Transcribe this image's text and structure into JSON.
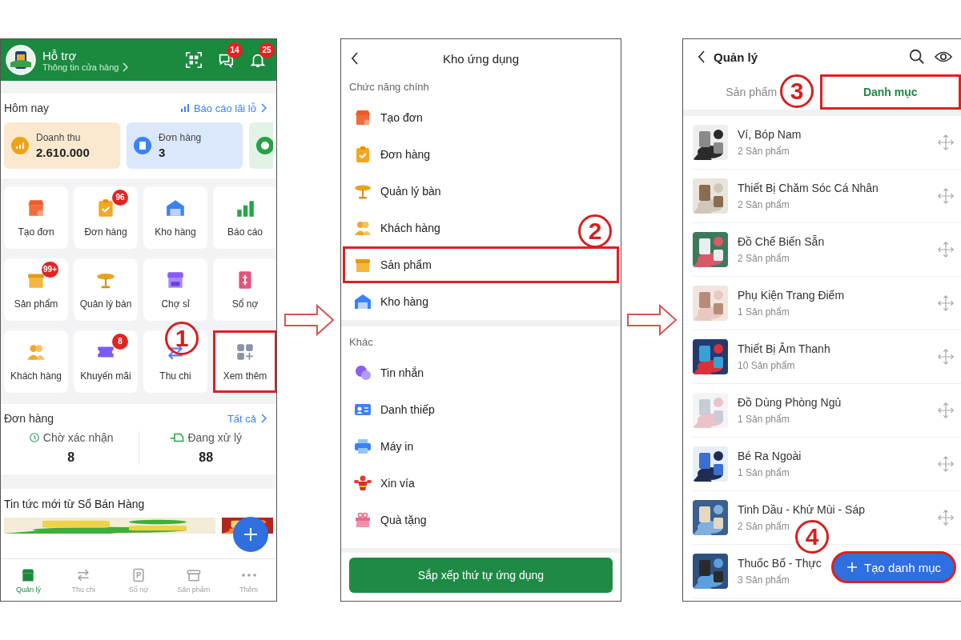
{
  "home": {
    "header": {
      "title": "Hỗ trợ",
      "subtitle": "Thông tin cửa hàng",
      "message_badge": "14",
      "notification_badge": "25"
    },
    "today": {
      "title": "Hôm nay",
      "report_link": "Báo cáo lãi lỗ"
    },
    "stat_cards": [
      {
        "kind": "revenue",
        "label": "Doanh thu",
        "value": "2.610.000"
      },
      {
        "kind": "orders",
        "label": "Đơn hàng",
        "value": "3"
      },
      {
        "kind": "cash"
      }
    ],
    "shortcuts": [
      {
        "label": "Tạo đơn",
        "highlighted": false
      },
      {
        "label": "Đơn hàng",
        "badge": "96",
        "highlighted": false
      },
      {
        "label": "Kho hàng",
        "highlighted": false
      },
      {
        "label": "Báo cáo",
        "highlighted": false
      },
      {
        "label": "Sản phẩm",
        "badge": "99+",
        "highlighted": false
      },
      {
        "label": "Quản lý bàn",
        "highlighted": false
      },
      {
        "label": "Chợ sỉ",
        "highlighted": false
      },
      {
        "label": "Sổ nợ",
        "highlighted": false
      },
      {
        "label": "Khách hàng",
        "highlighted": false
      },
      {
        "label": "Khuyến mãi",
        "badge": "8",
        "highlighted": false
      },
      {
        "label": "Thu chi",
        "highlighted": false
      },
      {
        "label": "Xem thêm",
        "highlighted": true
      }
    ],
    "orders": {
      "title": "Đơn hàng",
      "link": "Tất cả",
      "stats": [
        {
          "kind": "pending",
          "label": "Chờ xác nhận",
          "value": "8"
        },
        {
          "kind": "processing",
          "label": "Đang xử lý",
          "value": "88"
        }
      ]
    },
    "news": {
      "title": "Tin tức mới từ Sổ Bán Hàng"
    },
    "bottom_nav": [
      {
        "label": "Quản lý",
        "selected": true
      },
      {
        "label": "Thu chi",
        "selected": false
      },
      {
        "label": "Sổ nợ",
        "selected": false
      },
      {
        "label": "Sản phẩm",
        "selected": false
      },
      {
        "label": "Thêm",
        "selected": false
      }
    ]
  },
  "app_store": {
    "title": "Kho ứng dụng",
    "sections": [
      {
        "title": "Chức năng chính",
        "items": [
          {
            "label": "Tạo đơn",
            "highlighted": false
          },
          {
            "label": "Đơn hàng",
            "highlighted": false
          },
          {
            "label": "Quản lý bàn",
            "highlighted": false
          },
          {
            "label": "Khách hàng",
            "highlighted": false
          },
          {
            "label": "Sản phẩm",
            "highlighted": true
          },
          {
            "label": "Kho hàng",
            "highlighted": false
          }
        ]
      },
      {
        "title": "Khác",
        "items": [
          {
            "label": "Tin nhắn",
            "highlighted": false
          },
          {
            "label": "Danh thiếp",
            "highlighted": false
          },
          {
            "label": "Máy in",
            "highlighted": false
          },
          {
            "label": "Xin vía",
            "highlighted": false
          },
          {
            "label": "Quà tặng",
            "highlighted": false
          }
        ]
      }
    ],
    "button": "Sắp xếp thứ tự ứng dụng"
  },
  "categories": {
    "title": "Quản lý",
    "tabs": [
      {
        "label": "Sản phẩm",
        "selected": false,
        "highlighted": false
      },
      {
        "label": "Danh mục",
        "selected": true,
        "highlighted": true
      }
    ],
    "items": [
      {
        "name": "Ví, Bóp Nam",
        "count": "2 Sản phẩm",
        "handle": true
      },
      {
        "name": "Thiết Bị Chăm Sóc Cá Nhân",
        "count": "2 Sản phẩm",
        "handle": true
      },
      {
        "name": "Đồ Chế Biến Sẵn",
        "count": "2 Sản phẩm",
        "handle": true
      },
      {
        "name": "Phụ Kiện Trang Điểm",
        "count": "1 Sản phẩm",
        "handle": true
      },
      {
        "name": "Thiết Bị Âm Thanh",
        "count": "10 Sản phẩm",
        "handle": true
      },
      {
        "name": "Đồ Dùng Phòng Ngủ",
        "count": "1 Sản phẩm",
        "handle": true
      },
      {
        "name": "Bé Ra Ngoài",
        "count": "1 Sản phẩm",
        "handle": true
      },
      {
        "name": "Tinh Dầu - Khử Mùi - Sáp",
        "count": "2 Sản phẩm",
        "handle": true
      },
      {
        "name": "Thuốc Bổ - Thực",
        "count": "3 Sản phẩm",
        "handle": false
      }
    ],
    "add_button": {
      "label": "Tạo danh mục",
      "highlighted": true
    }
  },
  "steps": [
    "1",
    "2",
    "3",
    "4"
  ]
}
